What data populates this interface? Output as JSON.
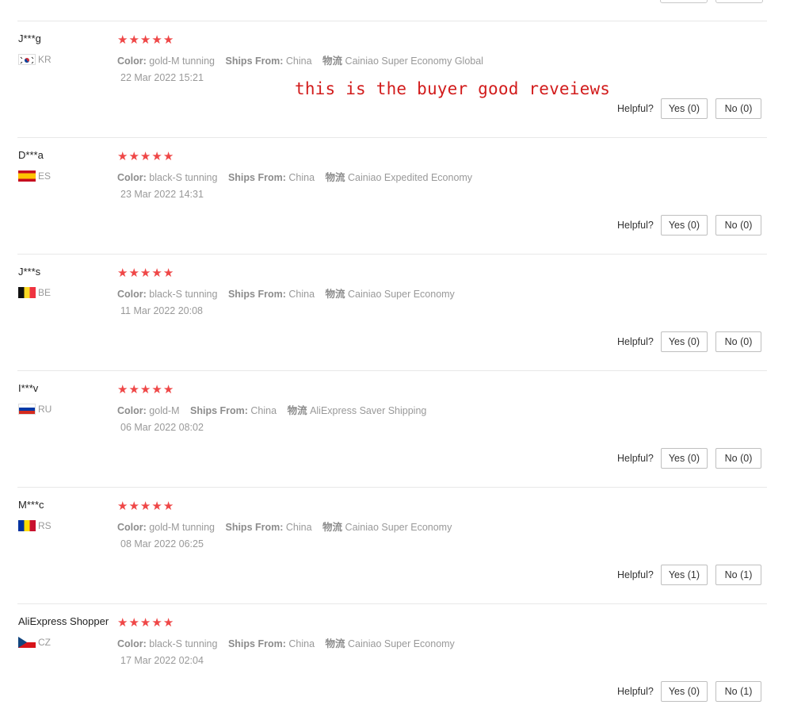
{
  "annotation": "this is the buyer good reveiews",
  "helpful_label": "Helpful?",
  "colors": {
    "star": "#ef4747",
    "annotation": "#d21c1c"
  },
  "reviews": [
    {
      "name": "J***g",
      "country": "KR",
      "flag": "kr-flag-icon",
      "rating": 5,
      "color_label": "Color:",
      "color": "gold-M tunning",
      "ships_label": "Ships From:",
      "ships_from": "China",
      "logistics_label": "物流",
      "logistics": "Cainiao Super Economy Global",
      "date": "22 Mar 2022 15:21",
      "yes": "Yes (0)",
      "no": "No (0)"
    },
    {
      "name": "D***a",
      "country": "ES",
      "flag": "es-flag-icon",
      "rating": 5,
      "color_label": "Color:",
      "color": "black-S tunning",
      "ships_label": "Ships From:",
      "ships_from": "China",
      "logistics_label": "物流",
      "logistics": "Cainiao Expedited Economy",
      "date": "23 Mar 2022 14:31",
      "yes": "Yes (0)",
      "no": "No (0)"
    },
    {
      "name": "J***s",
      "country": "BE",
      "flag": "be-flag-icon",
      "rating": 5,
      "color_label": "Color:",
      "color": "black-S tunning",
      "ships_label": "Ships From:",
      "ships_from": "China",
      "logistics_label": "物流",
      "logistics": "Cainiao Super Economy",
      "date": "11 Mar 2022 20:08",
      "yes": "Yes (0)",
      "no": "No (0)"
    },
    {
      "name": "I***v",
      "country": "RU",
      "flag": "ru-flag-icon",
      "rating": 5,
      "color_label": "Color:",
      "color": "gold-M",
      "ships_label": "Ships From:",
      "ships_from": "China",
      "logistics_label": "物流",
      "logistics": "AliExpress Saver Shipping",
      "date": "06 Mar 2022 08:02",
      "yes": "Yes (0)",
      "no": "No (0)"
    },
    {
      "name": "M***c",
      "country": "RS",
      "flag": "rs-flag-icon",
      "rating": 5,
      "color_label": "Color:",
      "color": "gold-M tunning",
      "ships_label": "Ships From:",
      "ships_from": "China",
      "logistics_label": "物流",
      "logistics": "Cainiao Super Economy",
      "date": "08 Mar 2022 06:25",
      "yes": "Yes (1)",
      "no": "No (1)"
    },
    {
      "name": "AliExpress Shopper",
      "country": "CZ",
      "flag": "cz-flag-icon",
      "rating": 5,
      "color_label": "Color:",
      "color": "black-S tunning",
      "ships_label": "Ships From:",
      "ships_from": "China",
      "logistics_label": "物流",
      "logistics": "Cainiao Super Economy",
      "date": "17 Mar 2022 02:04",
      "yes": "Yes (0)",
      "no": "No (1)"
    }
  ]
}
